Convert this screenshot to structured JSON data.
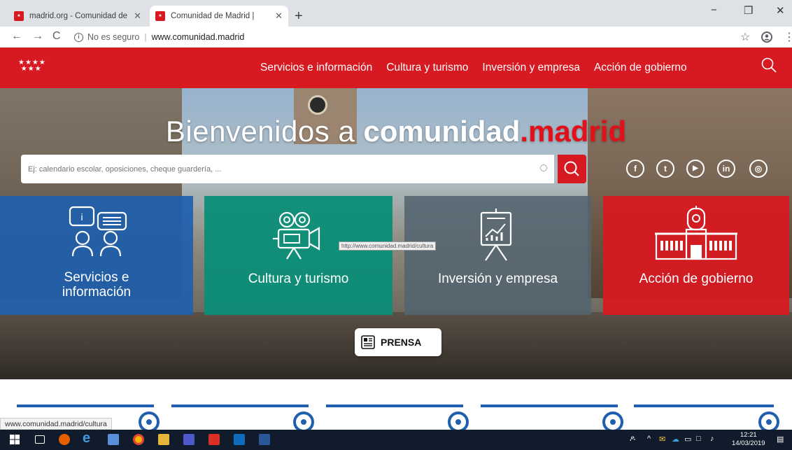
{
  "browser": {
    "tabs": [
      {
        "label": "madrid.org - Comunidad de Mad",
        "active": false
      },
      {
        "label": "Comunidad de Madrid |",
        "active": true
      }
    ],
    "new_tab": "+",
    "nav": {
      "back": "←",
      "forward": "→",
      "reload": "C"
    },
    "security": "No es seguro",
    "url": "www.comunidad.madrid",
    "window_controls": {
      "minimize": "−",
      "restore": "❐",
      "close": "✕"
    }
  },
  "site": {
    "brand_color": "#d71921",
    "logo_stars": "★★★★ ★★★",
    "nav": [
      "Servicios e información",
      "Cultura y turismo",
      "Inversión y empresa",
      "Acción de gobierno"
    ]
  },
  "hero": {
    "title_welcome": "Bienvenidos a ",
    "title_bold": "comunidad",
    "title_red": ".madrid",
    "search_placeholder": "Ej: calendario escolar, oposiciones, cheque guardería, ...",
    "social": [
      {
        "label": "f",
        "icon": "facebook-icon"
      },
      {
        "label": "t",
        "icon": "twitter-icon"
      },
      {
        "label": "▶",
        "icon": "youtube-icon"
      },
      {
        "label": "in",
        "icon": "linkedin-icon"
      },
      {
        "label": "◎",
        "icon": "instagram-icon"
      }
    ],
    "cards": [
      {
        "label_line1": "Servicios e",
        "label_line2": "información",
        "color": "#1f5fae",
        "icon": "people-chat-icon"
      },
      {
        "label_line1": "Cultura y turismo",
        "label_line2": "",
        "color": "#0b8e77",
        "icon": "film-camera-icon"
      },
      {
        "label_line1": "Inversión y empresa",
        "label_line2": "",
        "color": "#53646f",
        "icon": "growth-chart-icon"
      },
      {
        "label_line1": "Acción de gobierno",
        "label_line2": "",
        "color": "#d71921",
        "icon": "government-building-icon"
      }
    ],
    "tooltip": "http://www.comunidad.madrid/cultura",
    "prensa_label": "PRENSA"
  },
  "status_url": "www.comunidad.madrid/cultura",
  "taskbar": {
    "time": "12:21",
    "date": "14/03/2019"
  }
}
